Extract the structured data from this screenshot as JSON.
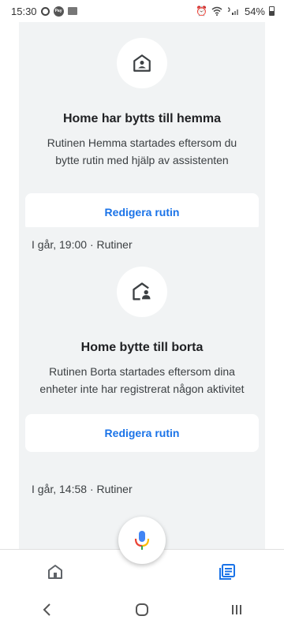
{
  "status_bar": {
    "time": "15:30",
    "battery": "54%"
  },
  "cards": [
    {
      "title": "Home har bytts till hemma",
      "description": "Rutinen Hemma startades eftersom du bytte rutin med hjälp av assistenten",
      "button_label": "Redigera rutin",
      "icon": "home-person-icon"
    },
    {
      "meta": "I går, 19:00 · Rutiner",
      "title": "Home bytte till borta",
      "description": "Rutinen Borta startades eftersom dina enheter inte har registrerat någon aktivitet",
      "button_label": "Redigera rutin",
      "icon": "home-away-person-icon"
    },
    {
      "meta": "I går, 14:58 · Rutiner"
    }
  ],
  "bottom_nav": {
    "items": [
      {
        "icon": "home-icon",
        "selected": false
      },
      {
        "icon": "feed-icon",
        "selected": true
      }
    ],
    "accent": "#1a73e8"
  },
  "colors": {
    "card_bg": "#f1f3f4",
    "accent": "#1a73e8"
  }
}
